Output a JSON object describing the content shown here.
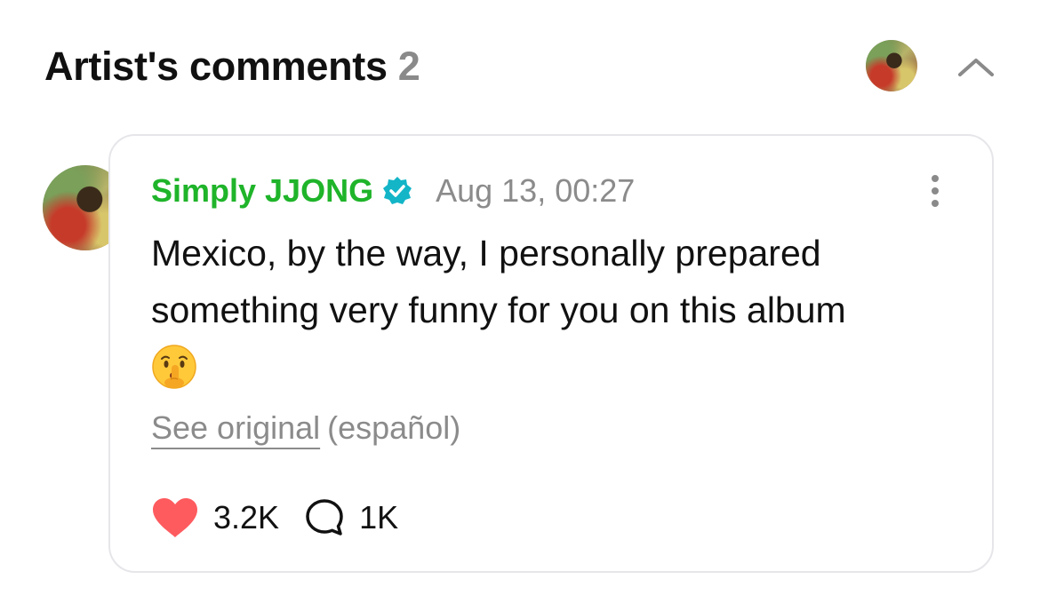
{
  "header": {
    "title": "Artist's comments",
    "count": "2"
  },
  "comment": {
    "author": "Simply JJONG",
    "timestamp": "Aug 13, 00:27",
    "text_line1": "Mexico, by the way, I personally prepared",
    "text_line2": "something very funny for you on this album",
    "emoji": "shushing-face",
    "see_original_label": "See original",
    "original_language": "(español)",
    "likes": "3.2K",
    "replies": "1K"
  },
  "icons": {
    "verified": "verified-badge-icon",
    "collapse": "chevron-up-icon",
    "more": "more-vertical-icon",
    "like": "heart-icon",
    "reply": "comment-bubble-icon"
  },
  "colors": {
    "author": "#1fb42a",
    "verified_badge": "#13b5c7",
    "heart": "#fe5b5f",
    "muted": "#8b8b8b",
    "card_border": "#e6e6ea"
  }
}
